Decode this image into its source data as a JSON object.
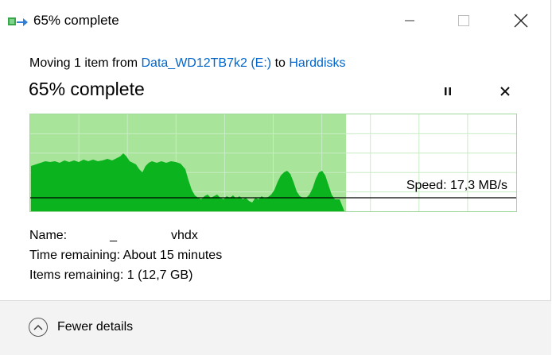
{
  "window": {
    "title": "65% complete"
  },
  "transfer": {
    "moving_prefix": "Moving 1 item from",
    "source": "Data_WD12TB7k2 (E:)",
    "connector": "to",
    "destination": "Harddisks",
    "progress_label": "65% complete",
    "progress_fraction": 0.65,
    "speed_label": "Speed: 17,3 MB/s"
  },
  "details": {
    "name_label": "Name:",
    "name_value": "_",
    "name_ext": "vhdx",
    "time_label": "Time remaining:",
    "time_value": "About 15 minutes",
    "items_label": "Items remaining:",
    "items_value": "1 (12,7 GB)"
  },
  "footer": {
    "fewer_details_label": "Fewer details"
  },
  "colors": {
    "graph_progress_fill": "#a8e59a",
    "graph_plot": "#0bb31e",
    "graph_grid": "#c8ecc4",
    "link": "#0066cc"
  },
  "icons": {
    "app": "file-copy-icon",
    "minimize": "minimize-icon",
    "maximize": "maximize-icon",
    "close": "close-icon",
    "pause": "pause-icon",
    "cancel": "cancel-icon",
    "collapse": "chevron-up-icon"
  }
}
